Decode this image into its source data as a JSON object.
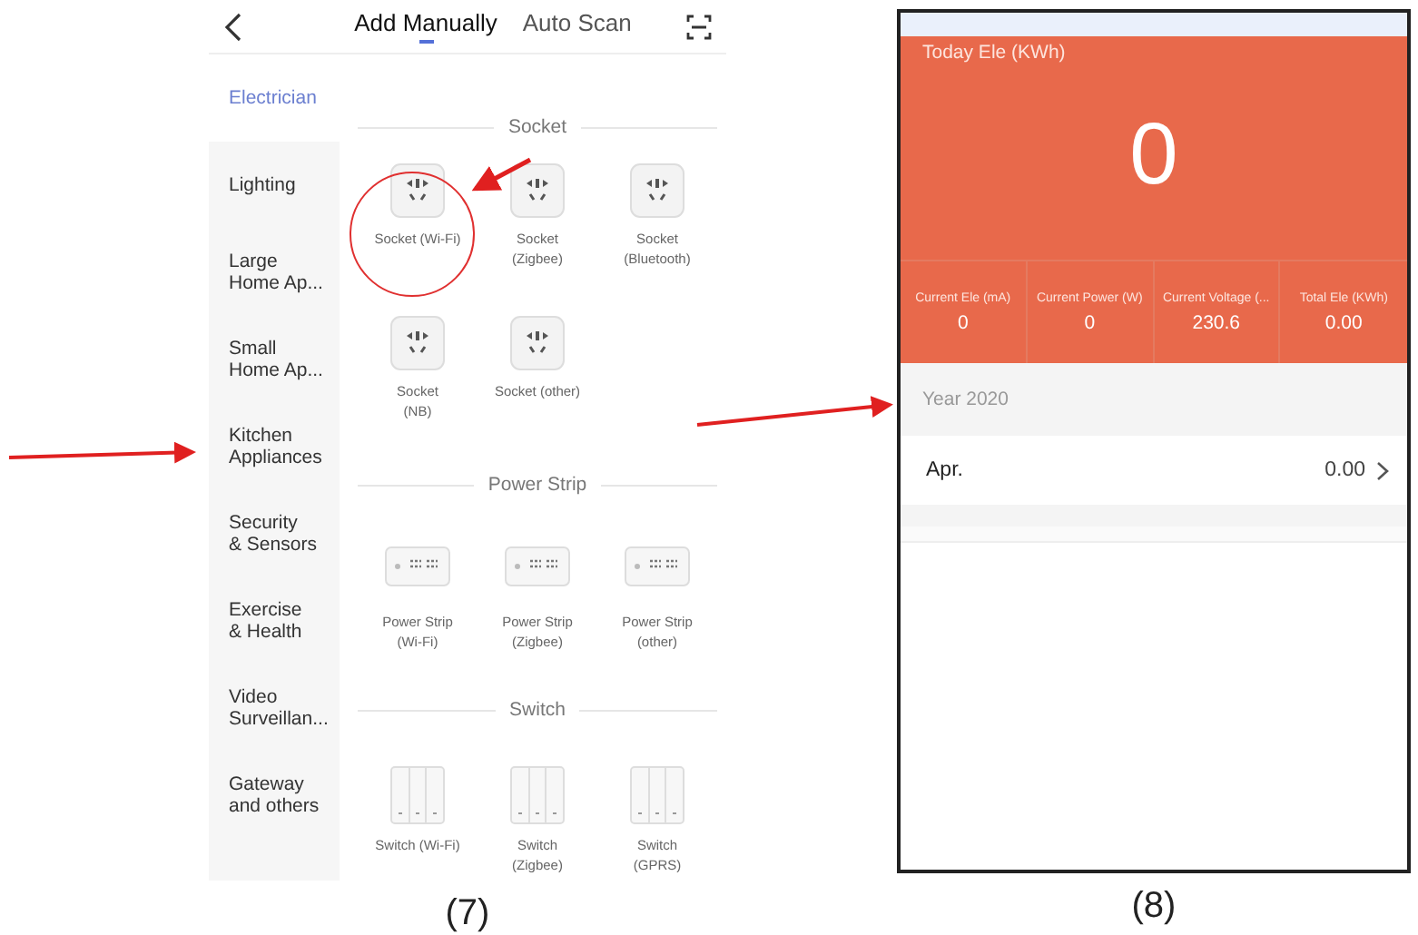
{
  "left_screen": {
    "tabs": [
      {
        "label": "Add Manually",
        "selected": true
      },
      {
        "label": "Auto Scan",
        "selected": false
      }
    ],
    "categories": [
      {
        "label": "Electrician",
        "selected": true
      },
      {
        "label": "Lighting",
        "selected": false
      },
      {
        "label": "Large\nHome Ap...",
        "selected": false
      },
      {
        "label": "Small\nHome Ap...",
        "selected": false
      },
      {
        "label": "Kitchen\nAppliances",
        "selected": false
      },
      {
        "label": "Security\n& Sensors",
        "selected": false
      },
      {
        "label": "Exercise\n& Health",
        "selected": false
      },
      {
        "label": "Video\nSurveillan...",
        "selected": false
      },
      {
        "label": "Gateway\nand others",
        "selected": false
      }
    ],
    "sections": [
      {
        "title": "Socket",
        "devices": [
          {
            "name": "Socket (Wi-Fi)",
            "kind": "socket"
          },
          {
            "name": "Socket\n(Zigbee)",
            "kind": "socket"
          },
          {
            "name": "Socket\n(Bluetooth)",
            "kind": "socket"
          },
          {
            "name": "Socket\n(NB)",
            "kind": "socket"
          },
          {
            "name": "Socket (other)",
            "kind": "socket"
          }
        ]
      },
      {
        "title": "Power Strip",
        "devices": [
          {
            "name": "Power Strip\n(Wi-Fi)",
            "kind": "strip"
          },
          {
            "name": "Power Strip\n(Zigbee)",
            "kind": "strip"
          },
          {
            "name": "Power Strip\n(other)",
            "kind": "strip"
          }
        ]
      },
      {
        "title": "Switch",
        "devices": [
          {
            "name": "Switch (Wi-Fi)",
            "kind": "switch"
          },
          {
            "name": "Switch\n(Zigbee)",
            "kind": "switch"
          },
          {
            "name": "Switch\n(GPRS)",
            "kind": "switch"
          }
        ]
      }
    ]
  },
  "right_screen": {
    "today_label": "Today Ele (KWh)",
    "today_value": "0",
    "stats": [
      {
        "label": "Current Ele (mA)",
        "value": "0"
      },
      {
        "label": "Current Power (W)",
        "value": "0"
      },
      {
        "label": "Current Voltage (...",
        "value": "230.6"
      },
      {
        "label": "Total Ele (KWh)",
        "value": "0.00"
      }
    ],
    "year_label": "Year 2020",
    "months": [
      {
        "month": "Apr.",
        "value": "0.00"
      }
    ]
  },
  "captions": [
    "(7)",
    "(8)"
  ]
}
